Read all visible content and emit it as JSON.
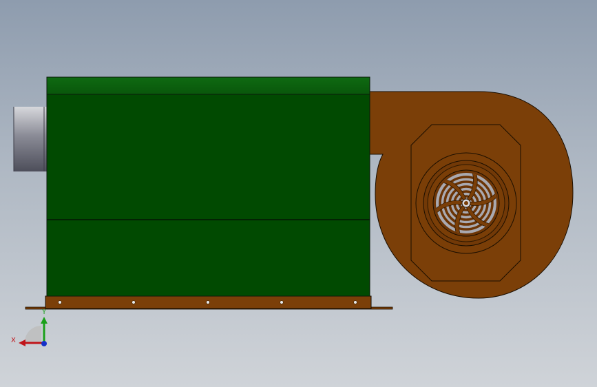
{
  "triad": {
    "x_label": "X",
    "y_label": "Y",
    "x_color": "#c0141a",
    "y_color": "#1aa01a",
    "z_color": "#1530c8"
  },
  "colors": {
    "background_top": "#8e9cae",
    "background_bottom": "#cfd3d8",
    "housing_green": "#014a01",
    "housing_top_green": "#0c6410",
    "blower_brown": "#7b3f08",
    "duct_gray": "#6e6f7c"
  }
}
